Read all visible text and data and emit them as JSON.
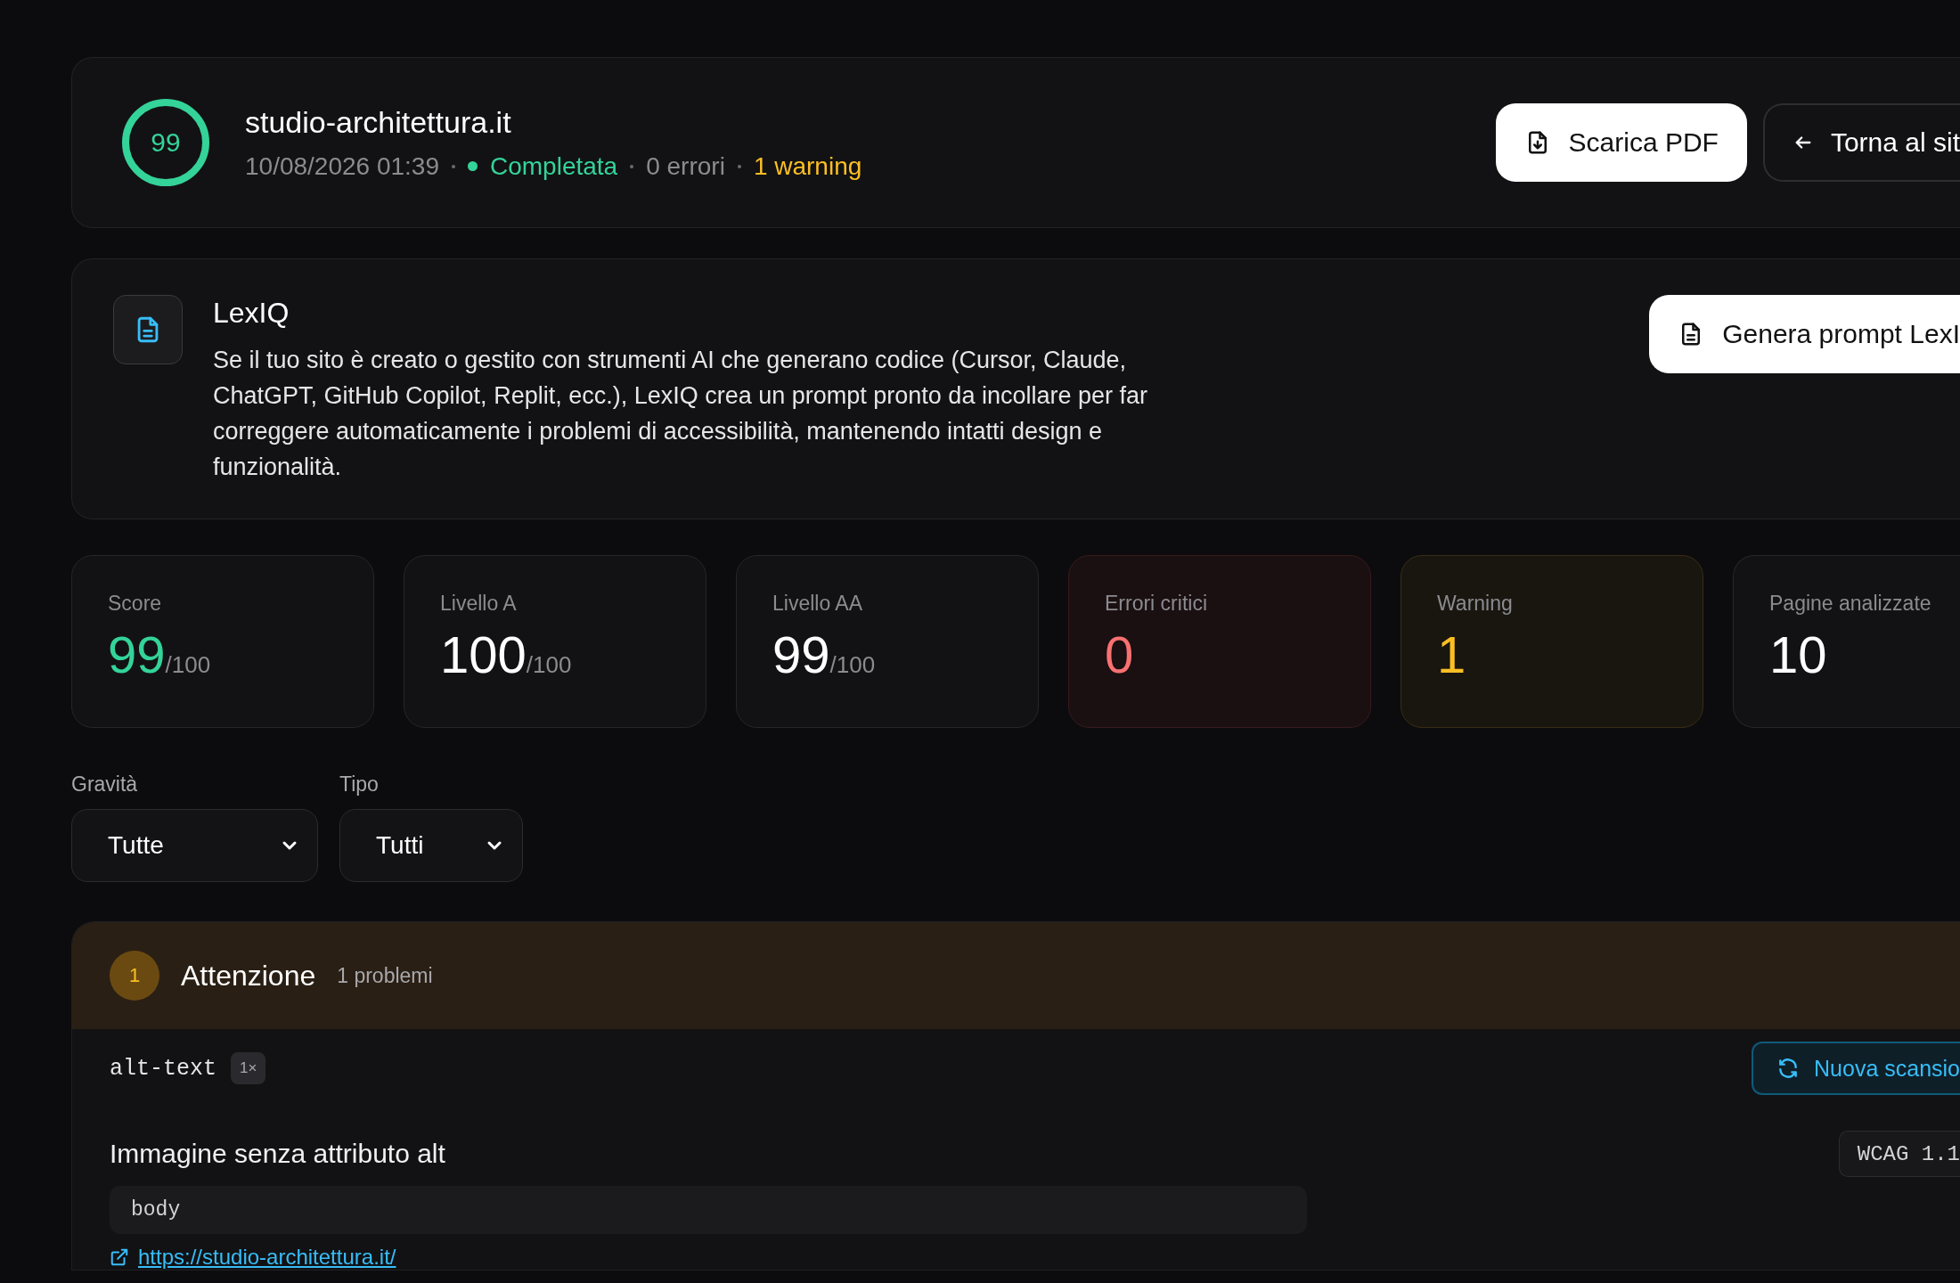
{
  "header": {
    "score": "99",
    "site": "studio-architettura.it",
    "meta": [
      {
        "text": "10/08/2026 01:39",
        "kind": "muted"
      },
      {
        "text": "Completata",
        "kind": "success"
      },
      {
        "text": "0 errori",
        "kind": "muted"
      },
      {
        "text": "1 warning",
        "kind": "warning"
      }
    ],
    "buttons": [
      {
        "label": "Scarica PDF",
        "kind": "primary"
      },
      {
        "label": "Torna al sit",
        "kind": "outline"
      }
    ]
  },
  "lexiq": {
    "title": "LexIQ",
    "text": "Se il tuo sito è creato o gestito con strumenti AI che generano codice (Cursor, Claude, ChatGPT, GitHub Copilot, Replit, ecc.), LexIQ crea un prompt pronto da incollare per far correggere automaticamente i problemi di accessibilità, mantenendo intatti design e funzionalità.",
    "button": "Genera prompt LexI"
  },
  "stats": [
    {
      "label": "Score",
      "value": "99",
      "suffix": "/100",
      "kind": "success"
    },
    {
      "label": "Livello A",
      "value": "100",
      "suffix": "/100",
      "kind": "neutral"
    },
    {
      "label": "Livello AA",
      "value": "99",
      "suffix": "/100",
      "kind": "neutral"
    },
    {
      "label": "Errori critici",
      "value": "0",
      "kind": "danger"
    },
    {
      "label": "Warning",
      "value": "1",
      "kind": "warning"
    },
    {
      "label": "Pagine analizzate",
      "value": "10",
      "kind": "neutral"
    }
  ],
  "filters": [
    {
      "label": "Gravità",
      "value": "Tutte"
    },
    {
      "label": "Tipo",
      "value": "Tutti"
    }
  ],
  "group": {
    "count": "1",
    "title": "Attenzione",
    "subtitle": "1 problemi",
    "rule": "alt-text",
    "occurrences": "1×",
    "rescan": "Nuova scansio",
    "issue_title": "Immagine senza attributo alt",
    "wcag": "WCAG 1.1",
    "selector": "body",
    "url": "https://studio-architettura.it/"
  }
}
